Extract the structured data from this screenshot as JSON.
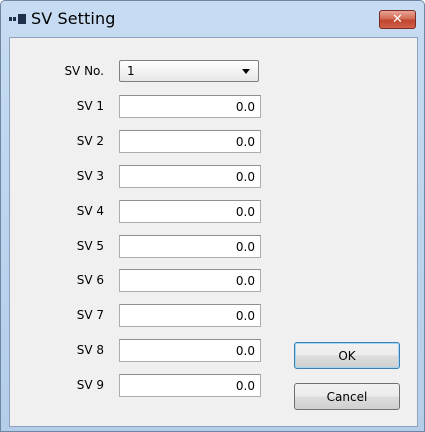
{
  "window": {
    "title": "SV Setting",
    "close_label": "✕",
    "icon": "app-window-icon",
    "close_icon": "close-icon"
  },
  "sv_no": {
    "label": "SV No.",
    "value": "1"
  },
  "sv_fields": [
    {
      "label": "SV 1",
      "value": "0.0"
    },
    {
      "label": "SV 2",
      "value": "0.0"
    },
    {
      "label": "SV 3",
      "value": "0.0"
    },
    {
      "label": "SV 4",
      "value": "0.0"
    },
    {
      "label": "SV 5",
      "value": "0.0"
    },
    {
      "label": "SV 6",
      "value": "0.0"
    },
    {
      "label": "SV 7",
      "value": "0.0"
    },
    {
      "label": "SV 8",
      "value": "0.0"
    },
    {
      "label": "SV 9",
      "value": "0.0"
    }
  ],
  "buttons": {
    "ok": "OK",
    "cancel": "Cancel"
  },
  "colors": {
    "title_bar": "#b4cde9",
    "close_button": "#c0442e",
    "client_background": "#f0f0f0",
    "default_button_border": "#3c7fb1"
  }
}
